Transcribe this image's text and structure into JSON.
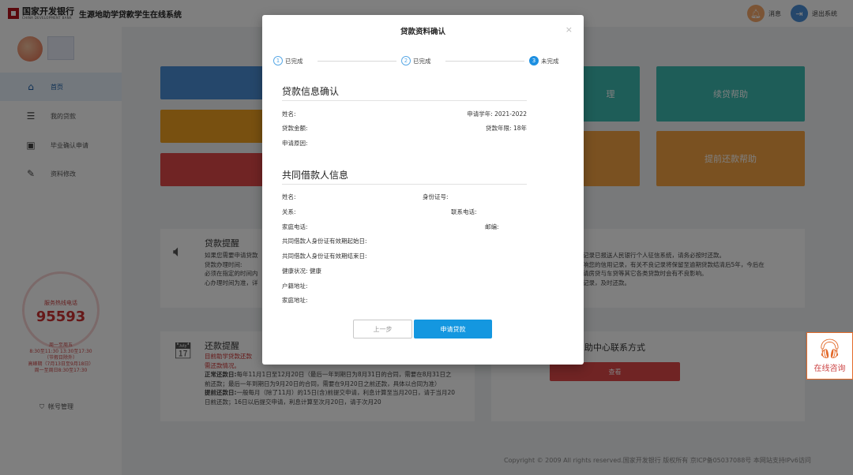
{
  "header": {
    "brand_cn": "国家开发银行",
    "brand_en": "CHINA DEVELOPMENT BANK",
    "system_title": "生源地助学贷款学生在线系统",
    "messages_label": "消息",
    "logout_label": "退出系统"
  },
  "sidebar": {
    "items": [
      {
        "label": "首页",
        "icon": "home-icon",
        "active": true
      },
      {
        "label": "我的贷款",
        "icon": "document-icon"
      },
      {
        "label": "毕业确认申请",
        "icon": "inbox-icon"
      },
      {
        "label": "资料修改",
        "icon": "edit-icon"
      }
    ],
    "hotline_label": "服务热线电话",
    "hotline_number": "95593",
    "hotline_notes": [
      "周一至周五",
      "8:30至11:30 13:30至17:30",
      "（节假日除外）",
      "高峰期（7月13日至9月18日）",
      "周一至周日8:30至17:30"
    ],
    "account_label": "帐号管理"
  },
  "tiles": {
    "renewal_help": "续贷帮助",
    "repay_process_partial": "理",
    "early_repay_help": "提前还款帮助"
  },
  "loan_reminder": {
    "title": "贷款提醒",
    "lines": [
      "如果您需要申请贷款",
      "贷款办理时间:",
      "必须在指定的时间内",
      "心办理时间为准，详"
    ]
  },
  "credit_panel": {
    "lines": [
      "记录已报送人民银行个人征信系统，请务必按时还款。",
      "响您的信用记录，有关不良记录将保留至逾期贷款结清后5年，今后在",
      "请房贷与车贷等其它各类贷款时会有不良影响。",
      "记录，及时还款。"
    ]
  },
  "repay_reminder": {
    "title": "还款提醒",
    "red_lines": [
      "目前助学贷款还款",
      "需还款情况。"
    ],
    "normal_label": "正常还款日:",
    "normal_text": "每年11月1日至12月20日（最后一年到期日为8月31日的合同，需要在8月31日之前还款；最后一年到期日为9月20日的合同，需要在9月20日之前还款，具体以合同为准）",
    "early_label": "提前还款日:",
    "early_text": "一般每月（除了11月）的15日(含)前提交申请，利息计算至当月20日，请于当月20日前还款；16日以后提交申请，利息计算至次月20日，请于次月20"
  },
  "contact_panel": {
    "title": "助中心联系方式",
    "view_button": "查看"
  },
  "footer": {
    "copyright": "Copyright © 2009 All rights reserved.国家开发银行 版权所有 京ICP备05037088号 本网站支持IPv6访问"
  },
  "modal": {
    "title": "贷款资料确认",
    "close": "×",
    "steps": [
      {
        "num": "1",
        "label": "已完成"
      },
      {
        "num": "2",
        "label": "已完成"
      },
      {
        "num": "3",
        "label": "未完成",
        "current": true
      }
    ],
    "loan_section": {
      "title": "贷款信息确认",
      "name_label": "姓名:",
      "year_label": "申请学年: 2021-2022",
      "amount_label": "贷款金额:",
      "term_label": "贷款年限: 18年",
      "reason_label": "申请原因:"
    },
    "co_section": {
      "title": "共同借款人信息",
      "name_label": "姓名:",
      "id_label": "身份证号:",
      "relation_label": "关系:",
      "phone_label": "联系电话:",
      "home_phone_label": "家庭电话:",
      "postcode_label": "邮编:",
      "id_start_label": "共同借款人身份证有效期起始日:",
      "id_end_label": "共同借款人身份证有效期结束日:",
      "health_label": "健康状况: 健康",
      "hukou_label": "户籍地址:",
      "home_addr_label": "家庭地址:"
    },
    "prev_button": "上一步",
    "apply_button": "申请贷款"
  },
  "online_help": {
    "label": "在线咨询"
  },
  "colors": {
    "tile_blue": "#4a8fd6",
    "tile_orange": "#f0a020",
    "tile_red": "#e04848",
    "tile_teal": "#3cbab0",
    "tile_amber": "#f5a243",
    "primary": "#1497e0"
  }
}
